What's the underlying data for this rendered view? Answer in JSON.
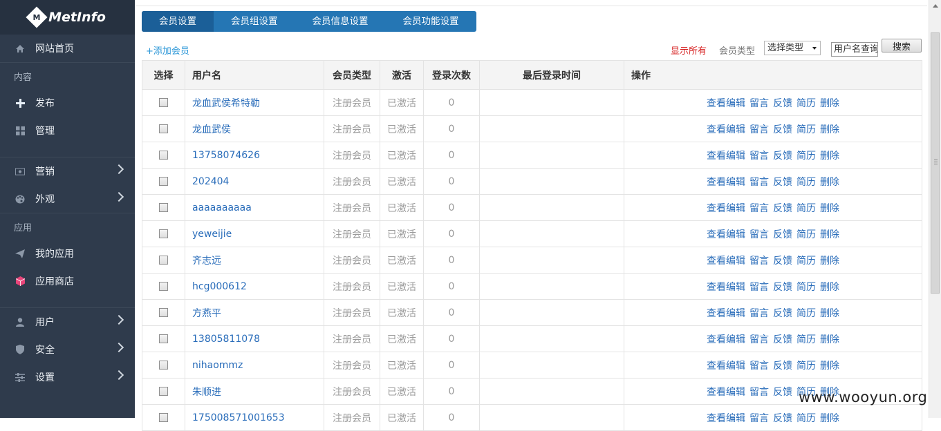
{
  "app": {
    "logo_mark": "M",
    "logo_text": "MetInfo"
  },
  "sidebar": {
    "home": {
      "label": "网站首页",
      "icon": "home-icon"
    },
    "group_content": "内容",
    "publish": {
      "label": "发布",
      "icon": "plus-icon"
    },
    "manage": {
      "label": "管理",
      "icon": "grid-icon"
    },
    "marketing": {
      "label": "营销",
      "icon": "money-icon"
    },
    "appearance": {
      "label": "外观",
      "icon": "palette-icon"
    },
    "group_apps": "应用",
    "my_apps": {
      "label": "我的应用",
      "icon": "paper-plane-icon"
    },
    "app_store": {
      "label": "应用商店",
      "icon": "cube-icon"
    },
    "users": {
      "label": "用户",
      "icon": "user-icon"
    },
    "security": {
      "label": "安全",
      "icon": "shield-icon"
    },
    "settings": {
      "label": "设置",
      "icon": "sliders-icon"
    }
  },
  "tabs": [
    "会员设置",
    "会员组设置",
    "会员信息设置",
    "会员功能设置"
  ],
  "toolbar": {
    "add_member": "+添加会员",
    "show_all": "显示所有",
    "type_label": "会员类型",
    "type_select": "选择类型",
    "search_value": "用户名查询",
    "search_button": "搜索"
  },
  "table": {
    "headers": [
      "选择",
      "用户名",
      "会员类型",
      "激活",
      "登录次数",
      "最后登录时间",
      "操作"
    ],
    "rows": [
      {
        "username": "龙血武侯希特勒",
        "type": "注册会员",
        "active": "已激活",
        "logins": "0",
        "last_login": ""
      },
      {
        "username": "龙血武侯",
        "type": "注册会员",
        "active": "已激活",
        "logins": "0",
        "last_login": ""
      },
      {
        "username": "13758074626",
        "type": "注册会员",
        "active": "已激活",
        "logins": "0",
        "last_login": ""
      },
      {
        "username": "202404",
        "type": "注册会员",
        "active": "已激活",
        "logins": "0",
        "last_login": ""
      },
      {
        "username": "aaaaaaaaaa",
        "type": "注册会员",
        "active": "已激活",
        "logins": "0",
        "last_login": ""
      },
      {
        "username": "yeweijie",
        "type": "注册会员",
        "active": "已激活",
        "logins": "0",
        "last_login": ""
      },
      {
        "username": "齐志远",
        "type": "注册会员",
        "active": "已激活",
        "logins": "0",
        "last_login": ""
      },
      {
        "username": "hcg000612",
        "type": "注册会员",
        "active": "已激活",
        "logins": "0",
        "last_login": ""
      },
      {
        "username": "方燕平",
        "type": "注册会员",
        "active": "已激活",
        "logins": "0",
        "last_login": ""
      },
      {
        "username": "13805811078",
        "type": "注册会员",
        "active": "已激活",
        "logins": "0",
        "last_login": ""
      },
      {
        "username": "nihaommz",
        "type": "注册会员",
        "active": "已激活",
        "logins": "0",
        "last_login": ""
      },
      {
        "username": "朱顺进",
        "type": "注册会员",
        "active": "已激活",
        "logins": "0",
        "last_login": ""
      },
      {
        "username": "175008571001653",
        "type": "注册会员",
        "active": "已激活",
        "logins": "0",
        "last_login": ""
      }
    ],
    "actions": [
      "查看编辑",
      "留言",
      "反馈",
      "简历",
      "删除"
    ]
  },
  "watermark": "www.wooyun.org",
  "colors": {
    "sidebar_bg": "#2f3b4c",
    "tab_bg": "#2576b4",
    "tab_active": "#1b5f98",
    "link": "#2a6dba",
    "show_all": "#d61f1f"
  }
}
